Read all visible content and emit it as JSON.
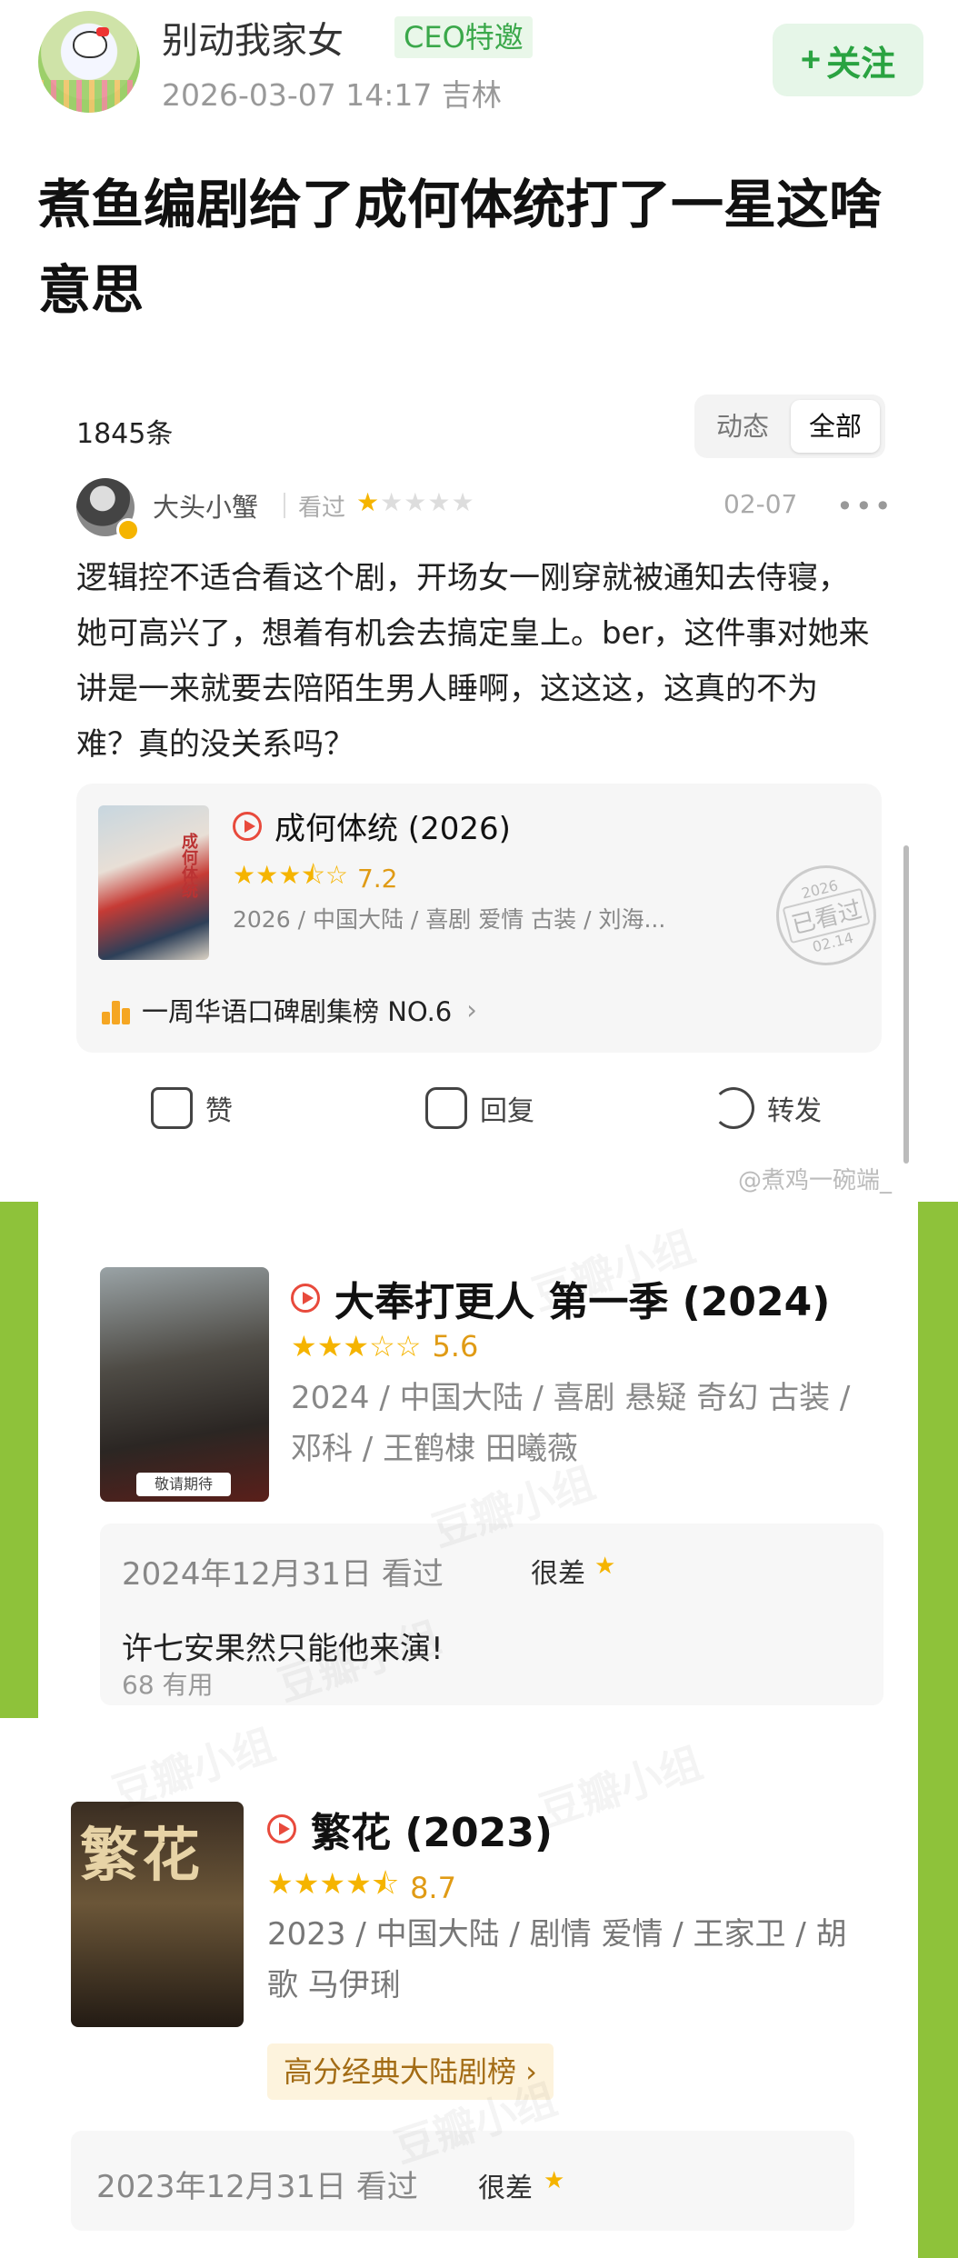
{
  "post": {
    "username": "别动我家女",
    "badge": "CEO特邀",
    "meta": "2026-03-07 14:17 吉林",
    "follow_label": "关注",
    "title": "煮鱼编剧给了成何体统打了一星这啥意思"
  },
  "review": {
    "count": "1845条",
    "tabs": [
      "动态",
      "全部"
    ],
    "reviewer": "大头小蟹",
    "watched_label": "看过",
    "stars": "★☆☆☆☆",
    "rating_stars": 1,
    "date": "02-07",
    "text": "逻辑控不适合看这个剧，开场女一刚穿就被通知去侍寝，她可高兴了，想着有机会去搞定皇上。ber，这件事对她来讲是一来就要去陪陌生男人睡啊，这这这，这真的不为难？真的没关系吗？",
    "movie": {
      "title": "成何体统 (2026)",
      "stars": "★★★⯪☆",
      "score": "7.2",
      "info": "2026 / 中国大陆 / 喜剧 爱情 古装 / 刘海...",
      "stamp_year": "2026",
      "stamp_text": "已看过",
      "stamp_date": "02.14",
      "rank": "一周华语口碑剧集榜 NO.6"
    },
    "actions": {
      "like": "赞",
      "reply": "回复",
      "share": "转发"
    },
    "watermark": "@煮鸡一碗端_"
  },
  "movie2": {
    "title": "大奉打更人 第一季 (2024)",
    "stars": "★★★☆☆",
    "score": "5.6",
    "info": "2024 / 中国大陆 / 喜剧 悬疑 奇幻 古装 / 邓科 / 王鹤棣 田曦薇",
    "poster_badge": "敬请期待",
    "log_date": "2024年12月31日 看过",
    "verdict": "很差",
    "verdict_star": "★",
    "comment": "许七安果然只能他来演!",
    "useful": "68 有用"
  },
  "movie3": {
    "title": "繁花 (2023)",
    "stars": "★★★★⯪",
    "score": "8.7",
    "info": "2023 / 中国大陆 / 剧情 爱情 / 王家卫 / 胡歌 马伊琍",
    "poster_text": "繁花",
    "rank_tag": "高分经典大陆剧榜 ›",
    "log_date": "2023年12月31日 看过",
    "verdict": "很差",
    "verdict_star": "★"
  },
  "watermark_text": "豆瓣小组",
  "colors": {
    "brand_green": "#2aa341",
    "star": "#f5b400",
    "score": "#e09b15",
    "side_green": "#8ec23a"
  }
}
